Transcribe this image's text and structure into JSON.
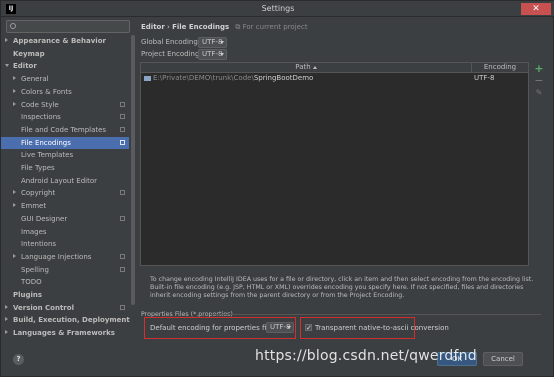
{
  "window": {
    "title": "Settings",
    "app_icon": "IJ",
    "close_glyph": "✕"
  },
  "search": {
    "placeholder": ""
  },
  "sidebar": {
    "items": [
      {
        "label": "Appearance & Behavior",
        "level": 0,
        "arrow": "right",
        "bold": true
      },
      {
        "label": "Keymap",
        "level": 0,
        "arrow": "",
        "bold": true
      },
      {
        "label": "Editor",
        "level": 0,
        "arrow": "down",
        "bold": true
      },
      {
        "label": "General",
        "level": 1,
        "arrow": "right"
      },
      {
        "label": "Colors & Fonts",
        "level": 1,
        "arrow": "right"
      },
      {
        "label": "Code Style",
        "level": 1,
        "arrow": "right",
        "project": true
      },
      {
        "label": "Inspections",
        "level": 1,
        "arrow": "",
        "project": true
      },
      {
        "label": "File and Code Templates",
        "level": 1,
        "arrow": "",
        "project": true
      },
      {
        "label": "File Encodings",
        "level": 1,
        "arrow": "",
        "project": true,
        "selected": true
      },
      {
        "label": "Live Templates",
        "level": 1,
        "arrow": ""
      },
      {
        "label": "File Types",
        "level": 1,
        "arrow": ""
      },
      {
        "label": "Android Layout Editor",
        "level": 1,
        "arrow": ""
      },
      {
        "label": "Copyright",
        "level": 1,
        "arrow": "right",
        "project": true
      },
      {
        "label": "Emmet",
        "level": 1,
        "arrow": "right"
      },
      {
        "label": "GUI Designer",
        "level": 1,
        "arrow": "",
        "project": true
      },
      {
        "label": "Images",
        "level": 1,
        "arrow": ""
      },
      {
        "label": "Intentions",
        "level": 1,
        "arrow": ""
      },
      {
        "label": "Language Injections",
        "level": 1,
        "arrow": "right",
        "project": true
      },
      {
        "label": "Spelling",
        "level": 1,
        "arrow": "",
        "project": true
      },
      {
        "label": "TODO",
        "level": 1,
        "arrow": ""
      },
      {
        "label": "Plugins",
        "level": 0,
        "arrow": "",
        "bold": true
      },
      {
        "label": "Version Control",
        "level": 0,
        "arrow": "right",
        "bold": true,
        "project": true
      },
      {
        "label": "Build, Execution, Deployment",
        "level": 0,
        "arrow": "right",
        "bold": true
      },
      {
        "label": "Languages & Frameworks",
        "level": 0,
        "arrow": "right",
        "bold": true
      }
    ]
  },
  "breadcrumb": {
    "section": "Editor",
    "separator": "›",
    "page": "File Encodings",
    "note": "For current project"
  },
  "global_encoding": {
    "label": "Global Encoding:",
    "value": "UTF-8"
  },
  "project_encoding": {
    "label": "Project Encoding:",
    "value": "UTF-8"
  },
  "table": {
    "columns": [
      "Path",
      "Encoding"
    ],
    "rows": [
      {
        "path_prefix": "E:\\Private\\DEMO\\trunk\\Code\\",
        "path_name": "SpringBootDemo",
        "encoding": "UTF-8"
      }
    ]
  },
  "toolbar": {
    "add": "+",
    "remove": "−",
    "edit": "✎"
  },
  "description": "To change encoding IntelliJ IDEA uses for a file or directory, click an item and then select encoding from the encoding list. Built-in file encoding (e.g. JSP, HTML or XML) overrides encoding you specify here. If not specified, files and directories inherit encoding settings from the parent directory or from the Project Encoding.",
  "properties": {
    "section_label": "Properties Files (*.properties)",
    "default_label": "Default encoding for properties files:",
    "default_value": "UTF-8",
    "native_to_ascii_label": "Transparent native-to-ascii conversion",
    "native_to_ascii_checked": true
  },
  "buttons": {
    "ok": "OK",
    "cancel": "Cancel",
    "help": "?"
  },
  "watermark": "https://blog.csdn.net/qwerdfnd",
  "colors": {
    "background": "#3c3f41",
    "selection": "#4b6eaf",
    "highlight_box": "#d32f2f",
    "add": "#59a869"
  }
}
